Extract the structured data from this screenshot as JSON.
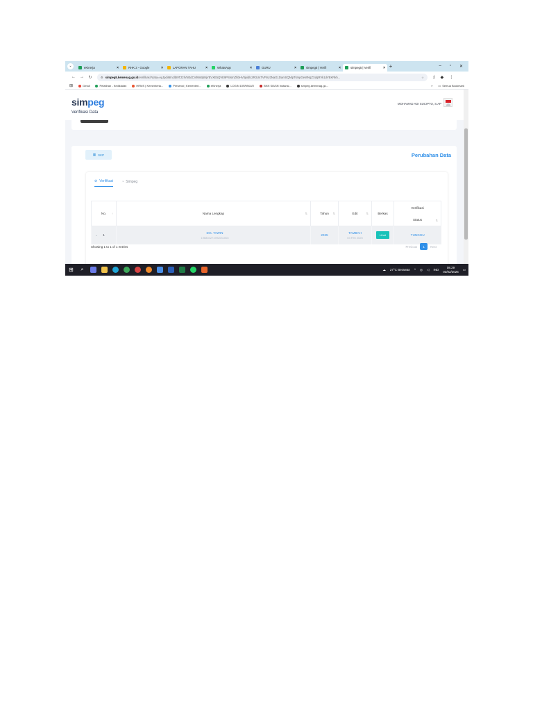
{
  "browser": {
    "tabs": [
      {
        "title": "eKinerja",
        "color": "#1e9e57",
        "active": false
      },
      {
        "title": "RHK 2 - Google",
        "color": "#f4b400",
        "active": false
      },
      {
        "title": "LAPORAN TAHU",
        "color": "#f4b400",
        "active": false
      },
      {
        "title": "WhatsApp",
        "color": "#25d366",
        "active": false
      },
      {
        "title": "GURU",
        "color": "#4a7fd8",
        "active": false
      },
      {
        "title": "simpeg5 | Verifi",
        "color": "#1e9e57",
        "active": false
      },
      {
        "title": "simpeg5 | Verifi",
        "color": "#1e9e57",
        "active": true
      }
    ],
    "url_host": "simpeg5.kemenag.go.id",
    "url_path": "/verifikasi?data=eyJpdiI6InJlbI9TZzlVNEdCVlMnBjWjVEVXE5QVE9PSIsInZhbHVlIjoidlc2R3U4TVF6U3NaG1DamSQNlpTkmpGeWNqZXdqRVk1dVEKRkh...",
    "window_min": "–",
    "window_max": "▫",
    "window_close": "✕",
    "bookmarks": [
      {
        "label": "Gmail",
        "color": "#ea4335"
      },
      {
        "label": "Pelatihan - Kediklatan",
        "color": "#1e9e57"
      },
      {
        "label": "HRMS | Kementeria...",
        "color": "#e8542f"
      },
      {
        "label": "Presensi | Kementeri...",
        "color": "#2f8fe8"
      },
      {
        "label": "eKinerja",
        "color": "#1e9e57"
      },
      {
        "label": "LOGIN DISPAKATI",
        "color": "#333333"
      },
      {
        "label": "BKN SIASN Instansi...",
        "color": "#c62828"
      },
      {
        "label": "simpeg.kemenag.go...",
        "color": "#333333"
      }
    ],
    "bookmarks_more": "»",
    "all_bookmarks": "Semua Bookmark"
  },
  "app": {
    "logo_a": "sim",
    "logo_b": "peg",
    "user_name": "MOHAMAD ADI SUCIPTO, S.AP",
    "page_title": "Verifikasi Data",
    "skp_label": "SKP",
    "card_title": "Perubahan Data",
    "tabs": [
      {
        "label": "Verifikasi",
        "active": true
      },
      {
        "label": "Simpeg",
        "active": false
      }
    ],
    "table": {
      "headers": {
        "no": "No.",
        "nama": "Nama Lengkap",
        "tahun": "Tahun",
        "edit": "Edit",
        "berkas": "Berkas",
        "verifikasi": "Verifikasi",
        "status": "Status"
      },
      "rows": [
        {
          "no": "1",
          "nama": "Drs. TAWIN",
          "nip": "196804271992031003",
          "tahun": "2025",
          "edit": "TAMBAH",
          "edit_date": "03 Feb 2025",
          "berkas": "Lihat",
          "status": "TUNGGU"
        }
      ]
    },
    "showing": "Showing 1 to 1 of 1 entries",
    "pager": {
      "previous": "Previous",
      "current": "1",
      "next": "Next"
    }
  },
  "taskbar": {
    "weather": "27°C  Berawan",
    "lang": "IND",
    "time": "08.29",
    "date": "03/02/2025"
  }
}
